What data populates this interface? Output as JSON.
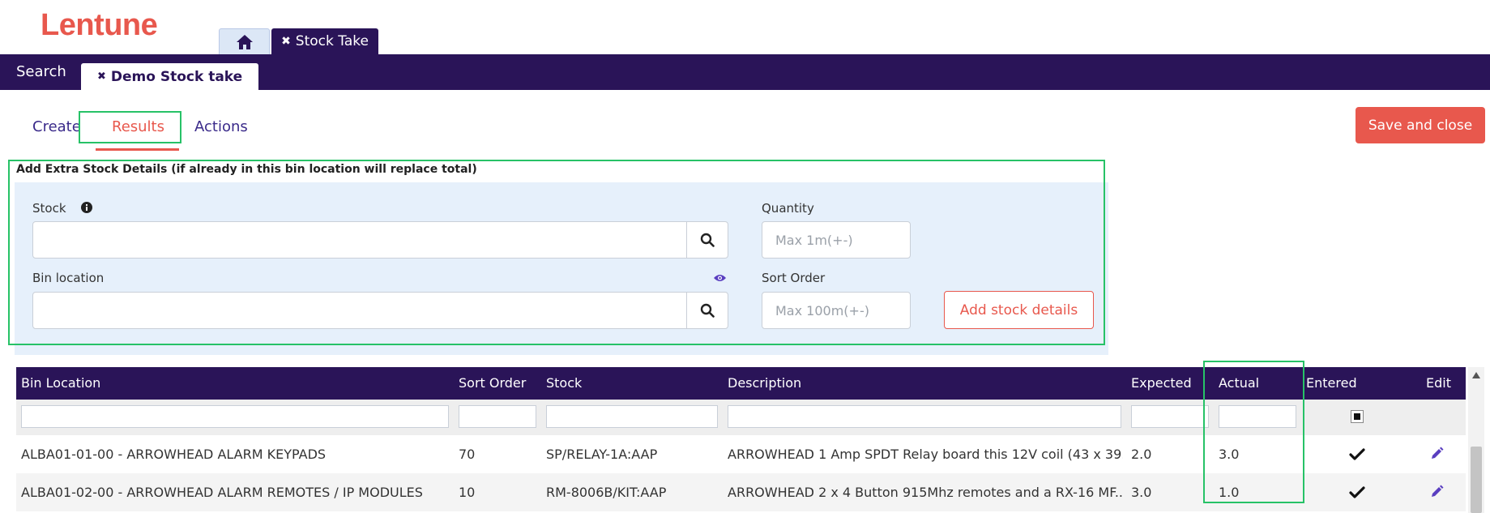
{
  "brand": {
    "name": "Lentune",
    "color": "#e8584d"
  },
  "colors": {
    "primary": "#2a1458",
    "accent": "#e8584d",
    "highlight": "#27c267",
    "panel": "#e6f0fb"
  },
  "top_tabs": {
    "home_icon": "home-icon",
    "stock_take_label": "Stock Take"
  },
  "nav": {
    "search_label": "Search",
    "active_tab_label": "Demo Stock take"
  },
  "subtabs": {
    "create": "Create",
    "results": "Results",
    "actions": "Actions"
  },
  "toolbar": {
    "save_label": "Save and close"
  },
  "form": {
    "title": "Add Extra Stock Details (if already in this bin location will replace total)",
    "stock_label": "Stock",
    "stock_value": "",
    "bin_label": "Bin location",
    "bin_value": "",
    "quantity_label": "Quantity",
    "quantity_placeholder": "Max 1m(+-)",
    "sort_label": "Sort Order",
    "sort_placeholder": "Max 100m(+-)",
    "add_label": "Add stock details"
  },
  "table": {
    "columns": [
      "Bin Location",
      "Sort Order",
      "Stock",
      "Description",
      "Expected",
      "Actual",
      "Entered",
      "Edit"
    ],
    "rows": [
      {
        "bin": "ALBA01-01-00 - ARROWHEAD ALARM KEYPADS",
        "sort": "70",
        "stock": "SP/RELAY-1A:AAP",
        "description": "ARROWHEAD 1 Amp SPDT Relay board this 12V coil (43 x 39...",
        "expected": "2.0",
        "actual": "3.0"
      },
      {
        "bin": "ALBA01-02-00 - ARROWHEAD ALARM REMOTES / IP MODULES",
        "sort": "10",
        "stock": "RM-8006B/KIT:AAP",
        "description": "ARROWHEAD 2 x 4 Button 915Mhz remotes and a RX-16 MF...",
        "expected": "3.0",
        "actual": "1.0"
      }
    ]
  }
}
